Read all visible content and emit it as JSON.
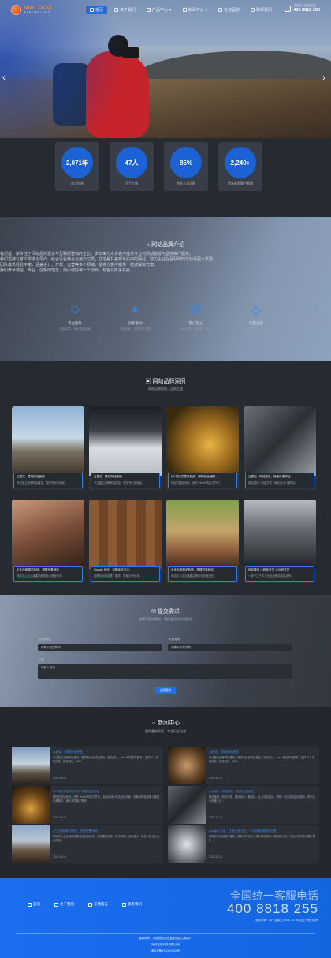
{
  "header": {
    "logo_title": "NIRLOCO",
    "logo_sub": "WEBSITE LOGO",
    "nav": [
      {
        "label": "首页",
        "active": true
      },
      {
        "label": "关于我们",
        "active": false
      },
      {
        "label": "产品中心",
        "active": false
      },
      {
        "label": "新闻中心",
        "active": false
      },
      {
        "label": "在线留言",
        "active": false
      },
      {
        "label": "联系我们",
        "active": false
      }
    ],
    "hotline_label": "全国统一服务热线",
    "hotline_number": "400 8818 255"
  },
  "stats": [
    {
      "value": "2,071年",
      "label": "成立时间"
    },
    {
      "value": "47人",
      "label": "员工人数"
    },
    {
      "value": "85%",
      "label": "专业人员比例"
    },
    {
      "value": "2,240+",
      "label": "累计服务客户数量"
    }
  ],
  "intro": {
    "title": "网站品牌介绍",
    "para1": "我们是一家专注于网站品牌建设与互联网营销的企业，多年来为众多客户提供专业的网站建设与品牌推广服务。",
    "para2": "我们坚持以客户需求为导向，结合行业特点与用户习惯，打造兼具美观与实用的网站，助力企业在互联网时代获得更大发展。",
    "para3": "团队成员经验丰富，涵盖设计、开发、运营等多个领域，能够为客户提供一站式解决方案。",
    "para4": "我们秉承诚信、专业、创新的理念，用心做好每一个项目，与客户携手共赢。",
    "features": [
      {
        "title": "专业团队",
        "desc": "经验丰富，专业素质过硬"
      },
      {
        "title": "创新驱动",
        "desc": "持续创新，引领行业发展"
      },
      {
        "title": "客户至上",
        "desc": "用心服务，满足客户需求"
      },
      {
        "title": "可靠品质",
        "desc": "严格把控，品质值得信赖"
      }
    ]
  },
  "cases": {
    "title": "网站品牌案例",
    "subtitle": "网站品牌案例，品质之选",
    "items": [
      {
        "title": "云建站 - 建站网站营销",
        "desc": "专注独立品牌网站建设，提供专业化网站..."
      },
      {
        "title": "云建站 - 建站网站营销",
        "desc": "专注独立品牌网站建设，提供专业化网站..."
      },
      {
        "title": "H5 响应式建站系统，跨端完全适配",
        "desc": "响应式建站系统，用的 Html5 响应式开发..."
      },
      {
        "title": "云建站 - 网站建设，快速打造网站",
        "desc": "网站建设 / 网站开发 / 网站设计 / 做网站..."
      },
      {
        "title": "企业自助建站系统，搭建完善网站",
        "desc": "网站中心企业级建站服务及全面优化的..."
      },
      {
        "title": "Google 优化，谷歌优化方法...",
        "desc": "谷歌优化网站推广服务，搜索引擎优化..."
      },
      {
        "title": "企业自助建站系统，搭建完善网站",
        "desc": "网站中心企业级建站服务及全面优化..."
      },
      {
        "title": "网站建设 小程序开发 公众号开发",
        "desc": "一家专注于中小企业品牌网站建设的..."
      }
    ]
  },
  "form": {
    "title": "提交需求",
    "subtitle": "请填写您的需求，我们会尽快与您联系",
    "name_label": "您的称呼",
    "name_placeholder": "请输入您的称呼",
    "phone_label": "手机号码",
    "phone_placeholder": "请输入手机号码",
    "content_label": "内容",
    "content_placeholder": "请输入内容",
    "submit": "立即提交"
  },
  "news": {
    "title": "新闻中心",
    "subtitle": "提供最新资讯，专业行业动态",
    "items": [
      {
        "title": "云建站 - 建站网站营销",
        "desc": "专注独立品牌网站建设，提供专业化网站建设、网页设计、Java 网站开发服务，支持 PC+手机网站、微信网站、APP...",
        "date": "2025-06-29"
      },
      {
        "title": "云建站 - 建站网站营销",
        "desc": "专注独立品牌网站建设，提供专业化网站建设、网页设计、Java 网站开发服务，支持 PC+手机网站、微信网站、APP...",
        "date": "2025-06-29"
      },
      {
        "title": "H5 响应式建站系统，跨端完全适配",
        "desc": "响应式建站系统，用的 Html5 响应式开发，全面支持 H5 自适应布局，在各种终端设备上都能完美展示，满足不同客户需求...",
        "date": "2025-06-29"
      },
      {
        "title": "云建站 - 网站建设，快速打造网站",
        "desc": "网站建设、网站开发、网站设计、做网站、企业网站建设，提供一站式网站建设服务，助力企业快速上线...",
        "date": "2025-06-29"
      },
      {
        "title": "企业自助建站系统，搭建完善网站",
        "desc": "网站中心企业级建站服务及全面优化，自助建站系统，操作简单，功能强大，轻松打造专业企业网站...",
        "date": "2025-06-29"
      },
      {
        "title": "Google 优化，谷歌优化方法，一站式营销解决方案",
        "desc": "谷歌优化网站推广服务，搜索引擎优化，提升网站排名，增加曝光率，为企业带来更多潜在客户...",
        "date": "2025-06-29"
      }
    ]
  },
  "footer": {
    "nav": [
      "首页",
      "关于我们",
      "在线留言",
      "联系我们"
    ],
    "phone_title": "全国统一客服电话",
    "phone": "400 8818 255",
    "hours": "服务时间：周一至周五 09:00 - 17:30 法定节假日除外",
    "copy1": "版权所有，未经授权禁止复制或建立镜像！",
    "copy2": "深圳某某科技有限公司",
    "copy3": "粤ICP备XXXXXXXX号"
  },
  "colors": {
    "accent": "#1f6fe0",
    "footer": "#1b6ef0",
    "bg": "#262a31"
  }
}
